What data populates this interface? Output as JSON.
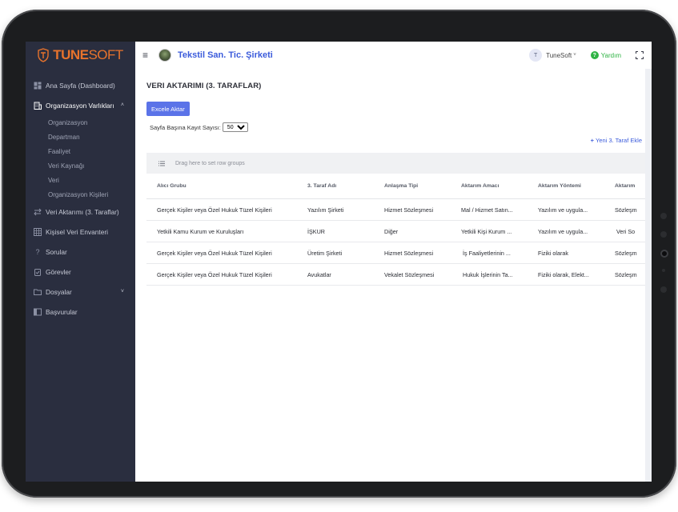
{
  "brand": {
    "part1": "TUNE",
    "part2": "SOFT",
    "accent": "#e8732c"
  },
  "sidebar": {
    "items": [
      {
        "label": "Ana Sayfa (Dashboard)",
        "icon": "dashboard-icon"
      },
      {
        "label": "Organizasyon Varlıkları",
        "icon": "building-icon",
        "expanded": true
      },
      {
        "label": "Veri Aktarımı (3. Taraflar)",
        "icon": "transfer-icon"
      },
      {
        "label": "Kişisel Veri Envanteri",
        "icon": "grid-icon"
      },
      {
        "label": "Sorular",
        "icon": "question-icon"
      },
      {
        "label": "Görevler",
        "icon": "clipboard-icon"
      },
      {
        "label": "Dosyalar",
        "icon": "folder-icon"
      },
      {
        "label": "Başvurular",
        "icon": "book-icon"
      }
    ],
    "subitems": [
      "Organizasyon",
      "Departman",
      "Faaliyet",
      "Veri Kaynağı",
      "Veri",
      "Organizasyon Kişileri"
    ]
  },
  "topbar": {
    "company": "Tekstil San. Tic. Şirketi",
    "user_initial": "T",
    "user_name": "TuneSoft",
    "help": "Yardım"
  },
  "page": {
    "title": "VERI AKTARIMI (3. TARAFLAR)",
    "excel_button": "Excele Aktar",
    "page_size_label": "Sayfa Başına Kayıt Sayısı:",
    "page_size_value": "50",
    "add_link": "Yeni 3. Taraf Ekle",
    "group_hint": "Drag here to set row groups"
  },
  "table": {
    "headers": [
      "Alıcı Grubu",
      "3. Taraf Adı",
      "Anlaşma Tipi",
      "Aktarım Amacı",
      "Aktarım Yöntemi",
      "Aktarım"
    ],
    "rows": [
      [
        "Gerçek Kişiler veya Özel Hukuk Tüzel Kişileri",
        "Yazılım Şirketi",
        "Hizmet Sözleşmesi",
        "Mal / Hizmet Satın...",
        "Yazılım ve uygula...",
        "Sözleşm"
      ],
      [
        "Yetkili Kamu Kurum ve Kuruluşları",
        "İŞKUR",
        "Diğer",
        "Yetkili Kişi Kurum ...",
        "Yazılım ve uygula...",
        "Veri So"
      ],
      [
        "Gerçek Kişiler veya Özel Hukuk Tüzel Kişileri",
        "Üretim Şirketi",
        "Hizmet Sözleşmesi",
        "İş Faaliyetlerinin ...",
        "Fiziki olarak",
        "Sözleşm"
      ],
      [
        "Gerçek Kişiler veya Özel Hukuk Tüzel Kişileri",
        "Avukatlar",
        "Vekalet Sözleşmesi",
        "Hukuk İşlerinin Ta...",
        "Fiziki olarak, Elekt...",
        "Sözleşm"
      ]
    ]
  },
  "colors": {
    "sidebar_bg": "#2a2e3f",
    "primary": "#5b73e8",
    "link": "#3b5bdb",
    "help": "#2fb344"
  }
}
